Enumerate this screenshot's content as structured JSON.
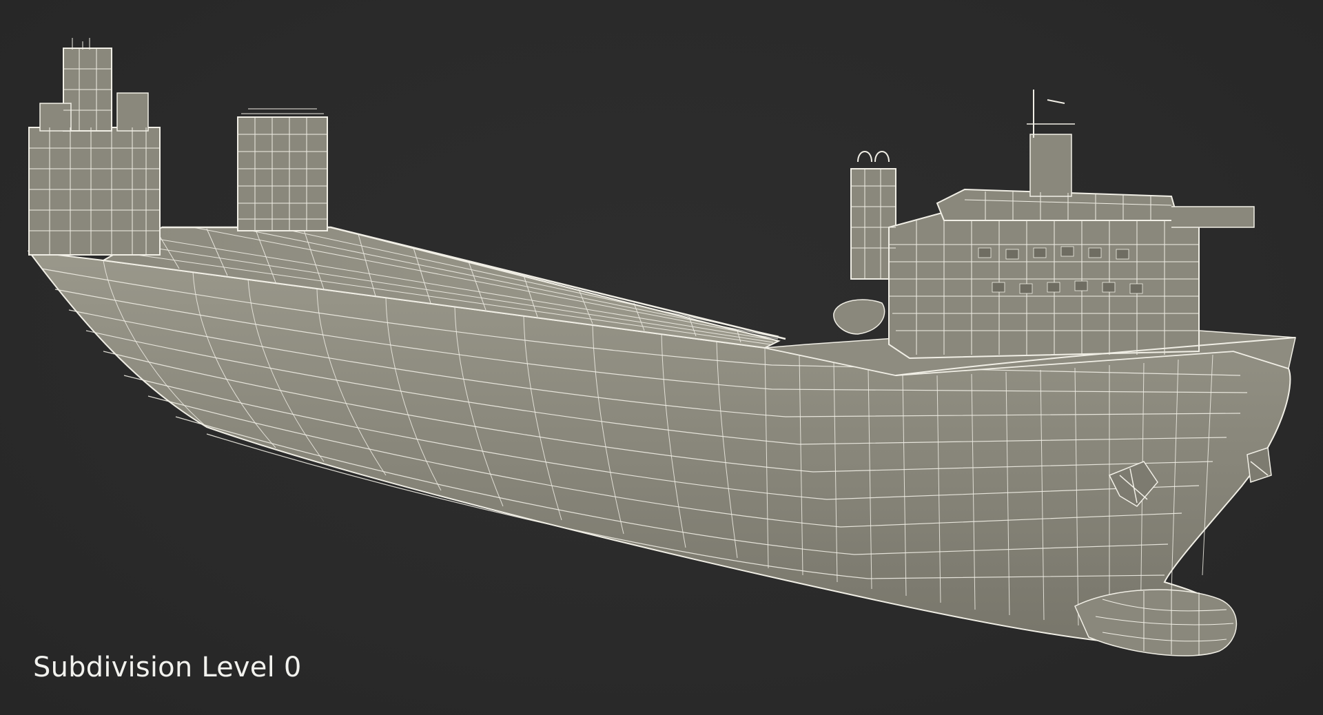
{
  "caption": {
    "text": "Subdivision Level 0"
  },
  "render": {
    "subject": "ship-wireframe",
    "colors": {
      "background": "#2b2b2b",
      "surface": "#8f8d80",
      "surface_shadow": "#6f6d62",
      "wire": "#f1efe6"
    }
  }
}
